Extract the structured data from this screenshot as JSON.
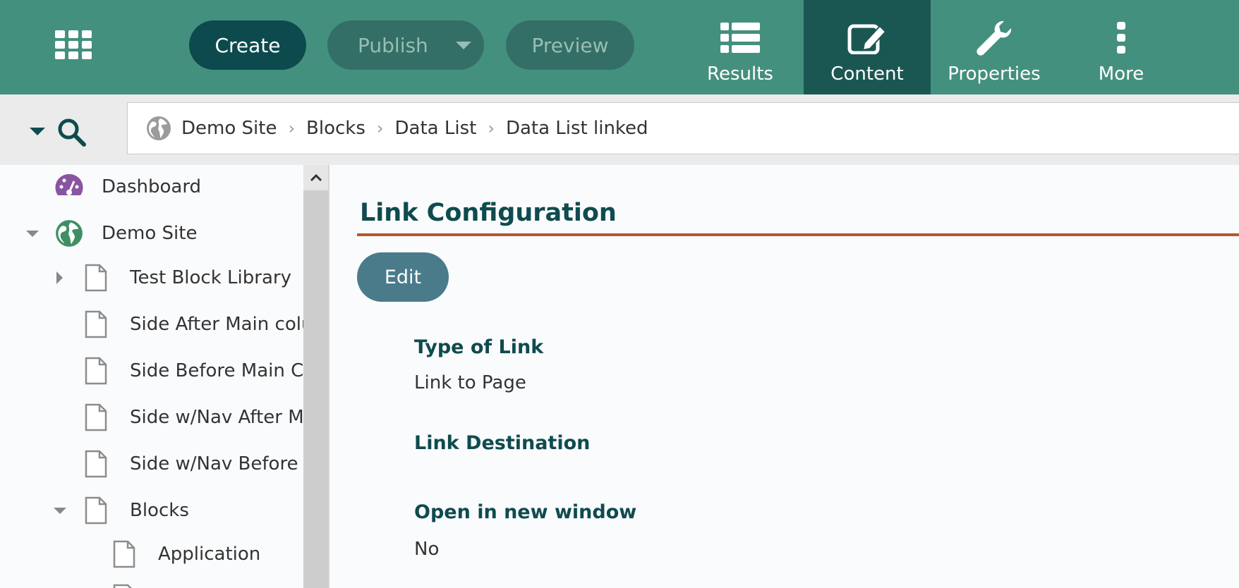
{
  "toolbar": {
    "create_label": "Create",
    "publish_label": "Publish",
    "preview_label": "Preview",
    "tabs": [
      {
        "label": "Results",
        "icon": "list-icon"
      },
      {
        "label": "Content",
        "icon": "edit-icon",
        "active": true
      },
      {
        "label": "Properties",
        "icon": "wrench-icon"
      },
      {
        "label": "More",
        "icon": "vertical-dots-icon"
      }
    ],
    "colors": {
      "bar": "#44907e",
      "active_tab": "#1b5752",
      "primary": "#0c4a4d"
    }
  },
  "breadcrumb": [
    "Demo Site",
    "Blocks",
    "Data List",
    "Data List linked"
  ],
  "sidebar": {
    "items": [
      {
        "label": "Dashboard",
        "icon": "dashboard-icon"
      },
      {
        "label": "Demo Site",
        "icon": "globe-icon",
        "expanded": true
      },
      {
        "label": "Test Block Library",
        "icon": "page-icon",
        "collapsed": true
      },
      {
        "label": "Side After Main colu",
        "icon": "page-icon"
      },
      {
        "label": "Side Before Main Co",
        "icon": "page-icon"
      },
      {
        "label": "Side w/Nav After Ma",
        "icon": "page-icon"
      },
      {
        "label": "Side w/Nav Before M",
        "icon": "page-icon"
      },
      {
        "label": "Blocks",
        "icon": "page-icon",
        "expanded": true
      },
      {
        "label": "Application",
        "icon": "page-icon"
      }
    ]
  },
  "panel": {
    "title": "Link Configuration",
    "edit_label": "Edit",
    "accent_color": "#b0592a",
    "fields": [
      {
        "label": "Type of Link",
        "value": "Link to Page"
      },
      {
        "label": "Link Destination",
        "value": ""
      },
      {
        "label": "Open in new window",
        "value": "No"
      }
    ]
  }
}
